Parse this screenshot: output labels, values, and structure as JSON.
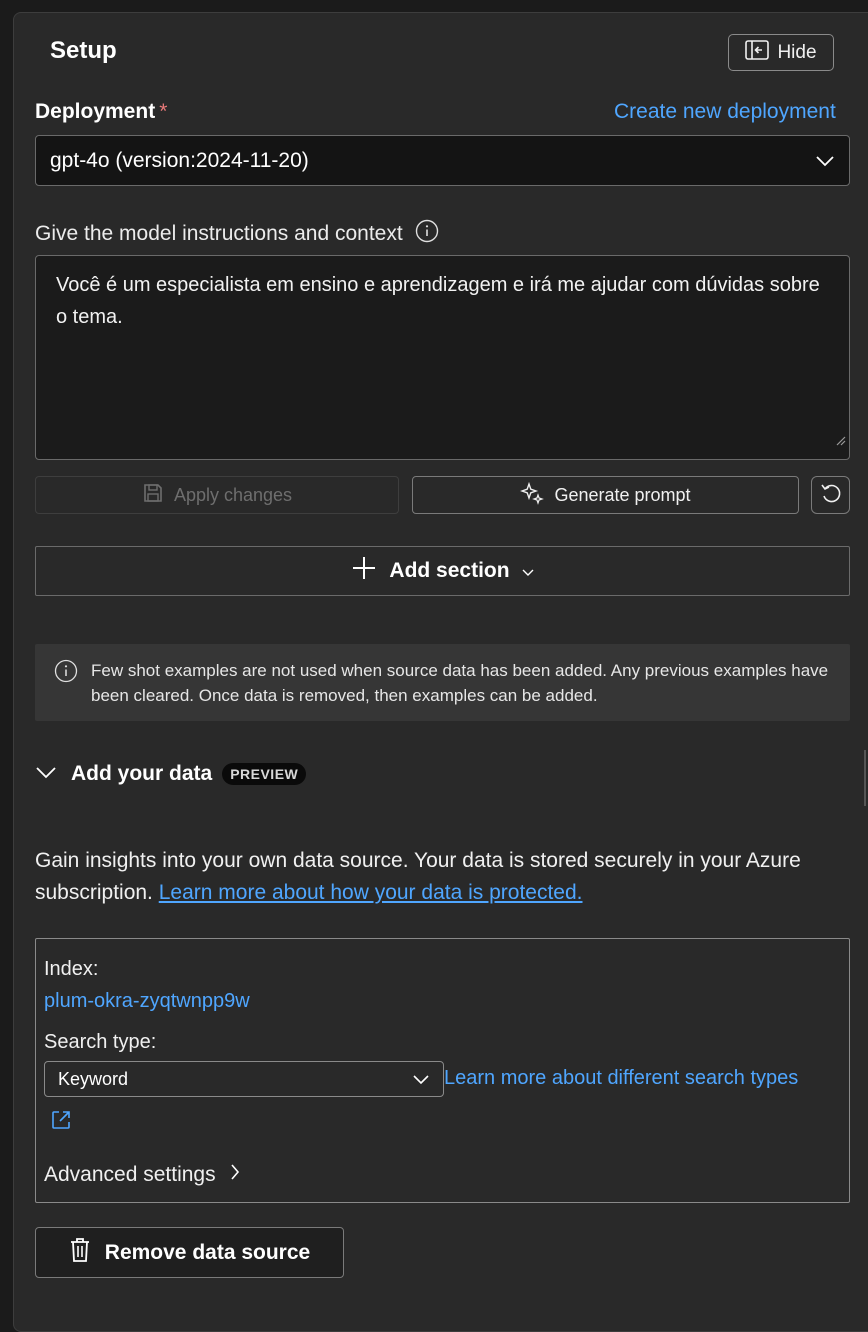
{
  "header": {
    "title": "Setup",
    "hide_label": "Hide"
  },
  "deployment": {
    "label": "Deployment",
    "required_mark": "*",
    "create_link": "Create new deployment",
    "selected": "gpt-4o (version:2024-11-20)"
  },
  "instructions": {
    "label": "Give the model instructions and context",
    "value": "Você é um especialista em ensino e aprendizagem e irá me ajudar com dúvidas sobre o tema."
  },
  "actions": {
    "apply_label": "Apply changes",
    "generate_label": "Generate prompt"
  },
  "add_section": {
    "label": "Add section"
  },
  "notice": {
    "text": "Few shot examples are not used when source data has been added. Any previous examples have been cleared. Once data is removed, then examples can be added."
  },
  "data_section": {
    "title": "Add your data",
    "badge": "PREVIEW",
    "description": "Gain insights into your own data source. Your data is stored securely in your Azure subscription.",
    "learn_link": "Learn more about how your data is protected.",
    "index_label": "Index:",
    "index_value": "plum-okra-zyqtwnpp9w",
    "search_type_label": "Search type:",
    "search_type_value": "Keyword",
    "search_types_link": "Learn more about different search types",
    "advanced_label": "Advanced settings",
    "remove_label": "Remove data source"
  },
  "colors": {
    "accent_link": "#4fa6ff",
    "panel_bg": "#292929",
    "required": "#e87979"
  }
}
